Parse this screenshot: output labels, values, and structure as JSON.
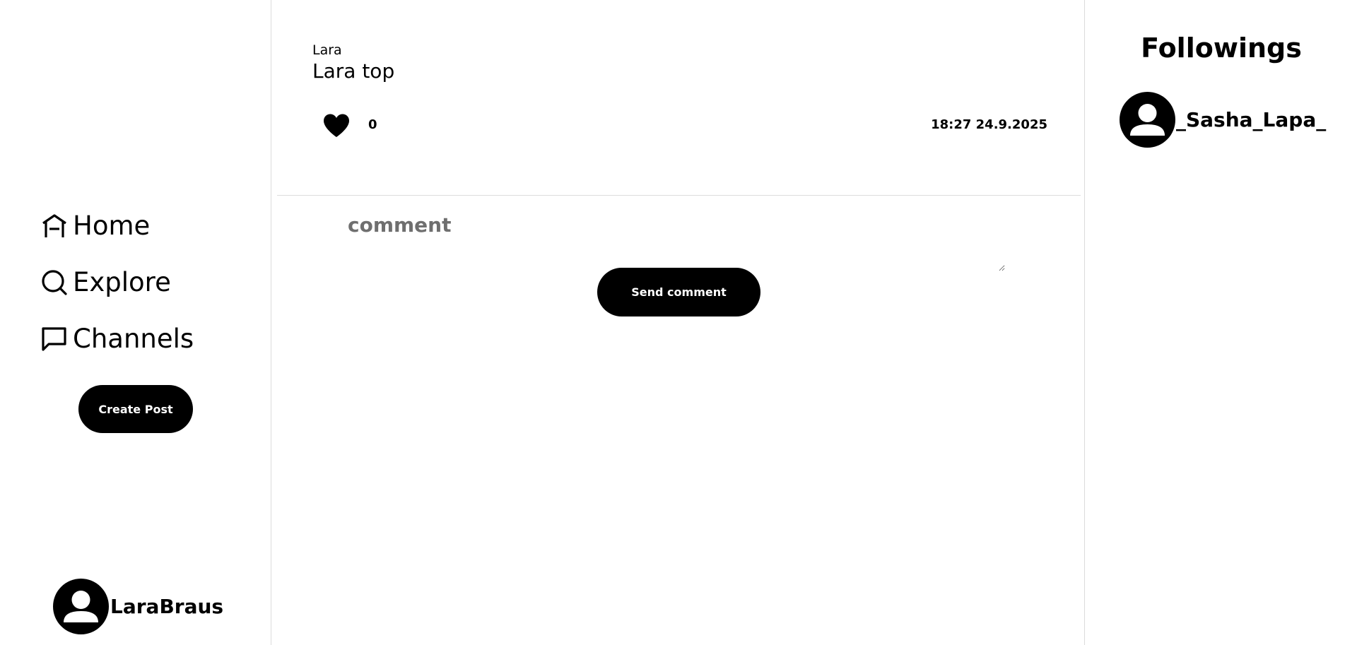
{
  "sidebar": {
    "nav": [
      {
        "label": "Home",
        "icon": "home-icon"
      },
      {
        "label": "Explore",
        "icon": "search-icon"
      },
      {
        "label": "Channels",
        "icon": "chat-bubble-icon"
      }
    ],
    "create_post_label": "Create Post",
    "profile": {
      "username": "LaraBraus",
      "icon": "avatar-icon"
    }
  },
  "post": {
    "author": "Lara",
    "text": "Lara top",
    "likes": "0",
    "timestamp": "18:27 24.9.2025",
    "like_icon": "heart-icon"
  },
  "comment": {
    "placeholder": "comment",
    "value": "",
    "send_label": "Send comment"
  },
  "followings": {
    "title": "Followings",
    "items": [
      {
        "username": "_Sasha_Lapa_",
        "icon": "avatar-icon"
      }
    ]
  },
  "colors": {
    "accent": "#000000",
    "divider": "#dcdcdc",
    "placeholder": "#6f6f6f",
    "background": "#ffffff"
  }
}
